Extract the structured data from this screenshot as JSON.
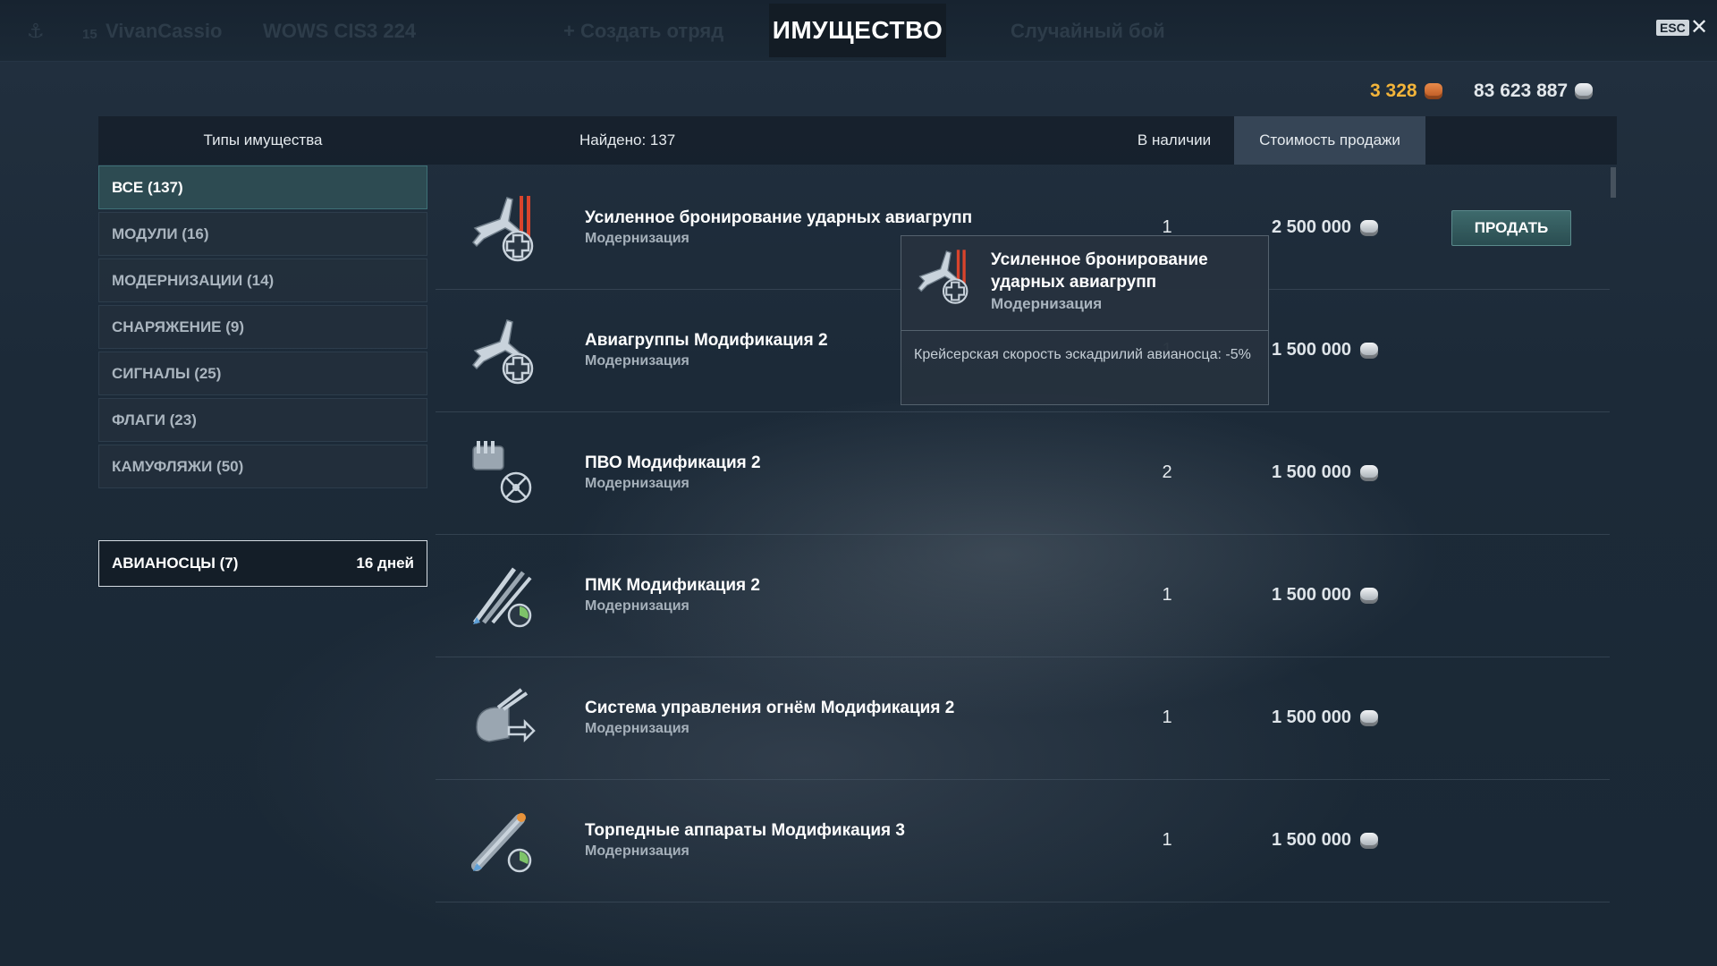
{
  "header": {
    "title": "ИМУЩЕСТВО",
    "esc_label": "ESC",
    "background_faded": {
      "level": "15",
      "player": "VivanCassio",
      "clan": "WOWS CIS",
      "clan_rating": "3 224",
      "create_division": "+ Создать отряд",
      "battle_mode": "Случайный бой"
    }
  },
  "currency": {
    "doubloons": "3 328",
    "credits": "83 623 887"
  },
  "columns": {
    "types": "Типы имущества",
    "found": "Найдено: 137",
    "in_stock": "В наличии",
    "sell_price": "Стоимость продажи"
  },
  "categories": [
    {
      "label": "ВСЕ (137)",
      "active": true
    },
    {
      "label": "МОДУЛИ (16)"
    },
    {
      "label": "МОДЕРНИЗАЦИИ (14)"
    },
    {
      "label": "СНАРЯЖЕНИЕ (9)"
    },
    {
      "label": "СИГНАЛЫ (25)"
    },
    {
      "label": "ФЛАГИ (23)"
    },
    {
      "label": "КАМУФЛЯЖИ (50)"
    }
  ],
  "filter": {
    "label": "АВИАНОСЦЫ (7)",
    "duration": "16 дней"
  },
  "items": [
    {
      "name": "Усиленное бронирование ударных авиагрупп",
      "type": "Модернизация",
      "qty": "1",
      "price": "2 500 000",
      "icon": "aircraft-armor-icon",
      "sell_label": "ПРОДАТЬ"
    },
    {
      "name": "Авиагруппы Модификация 2",
      "type": "Модернизация",
      "qty": "1",
      "price": "1 500 000",
      "icon": "air-groups-icon"
    },
    {
      "name": "ПВО Модификация 2",
      "type": "Модернизация",
      "qty": "2",
      "price": "1 500 000",
      "icon": "aa-guns-icon"
    },
    {
      "name": "ПМК Модификация 2",
      "type": "Модернизация",
      "qty": "1",
      "price": "1 500 000",
      "icon": "secondary-battery-icon"
    },
    {
      "name": "Система управления огнём Модификация 2",
      "type": "Модернизация",
      "qty": "1",
      "price": "1 500 000",
      "icon": "fire-control-icon"
    },
    {
      "name": "Торпедные аппараты Модификация 3",
      "type": "Модернизация",
      "qty": "1",
      "price": "1 500 000",
      "icon": "torpedo-tubes-icon"
    }
  ],
  "tooltip": {
    "name": "Усиленное бронирование ударных авиагрупп",
    "type": "Модернизация",
    "description": "Крейсерская скорость эскадрилий авианосца: -5%"
  },
  "colors": {
    "gold": "#f3b43a",
    "active_category": "#2d4b52",
    "sell_button": "#3e6a6c",
    "text_primary": "#ffffff"
  }
}
